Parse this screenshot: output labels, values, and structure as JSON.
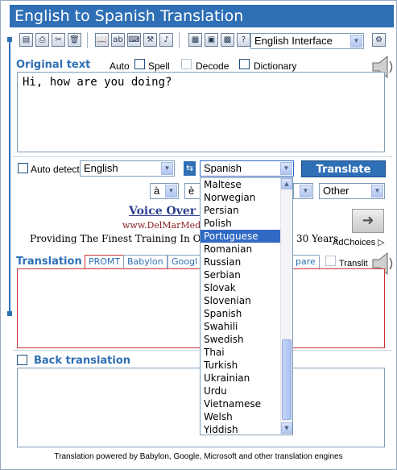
{
  "window": {
    "title": "English to Spanish Translation"
  },
  "toolbar": {
    "interface_select": "English Interface"
  },
  "original": {
    "label": "Original text",
    "options": {
      "auto": "Auto",
      "spell": "Spell",
      "decode": "Decode",
      "dictionary": "Dictionary"
    },
    "text": "Hi, how are you doing?"
  },
  "language_bar": {
    "auto_detect_label": "Auto detect",
    "source_language": "English",
    "target_language": "Spanish",
    "translate_button": "Translate",
    "char_select_1": "à",
    "char_select_2": "è",
    "other_select": "Other"
  },
  "ad": {
    "title": "Voice Over T",
    "url": "www.DelMarMed",
    "text": "Providing The Finest Training In Orang",
    "text_right": "30 Years",
    "adchoices": "AdChoices"
  },
  "translation": {
    "label": "Translation",
    "tabs": [
      "PROMT",
      "Babylon",
      "Googl",
      "pare"
    ],
    "translit_label": "Translit"
  },
  "back_translation": {
    "label": "Back translation"
  },
  "language_dropdown": {
    "items": [
      "Maltese",
      "Norwegian",
      "Persian",
      "Polish",
      "Portuguese",
      "Romanian",
      "Russian",
      "Serbian",
      "Slovak",
      "Slovenian",
      "Spanish",
      "Swahili",
      "Swedish",
      "Thai",
      "Turkish",
      "Ukrainian",
      "Urdu",
      "Vietnamese",
      "Welsh",
      "Yiddish"
    ],
    "highlighted": "Portuguese"
  },
  "footer": {
    "text": "Translation powered by Babylon, Google, Microsoft and other translation engines"
  },
  "colors": {
    "accent": "#2f6fb5",
    "highlight": "#316ac5",
    "translation_border": "#cc3333"
  }
}
